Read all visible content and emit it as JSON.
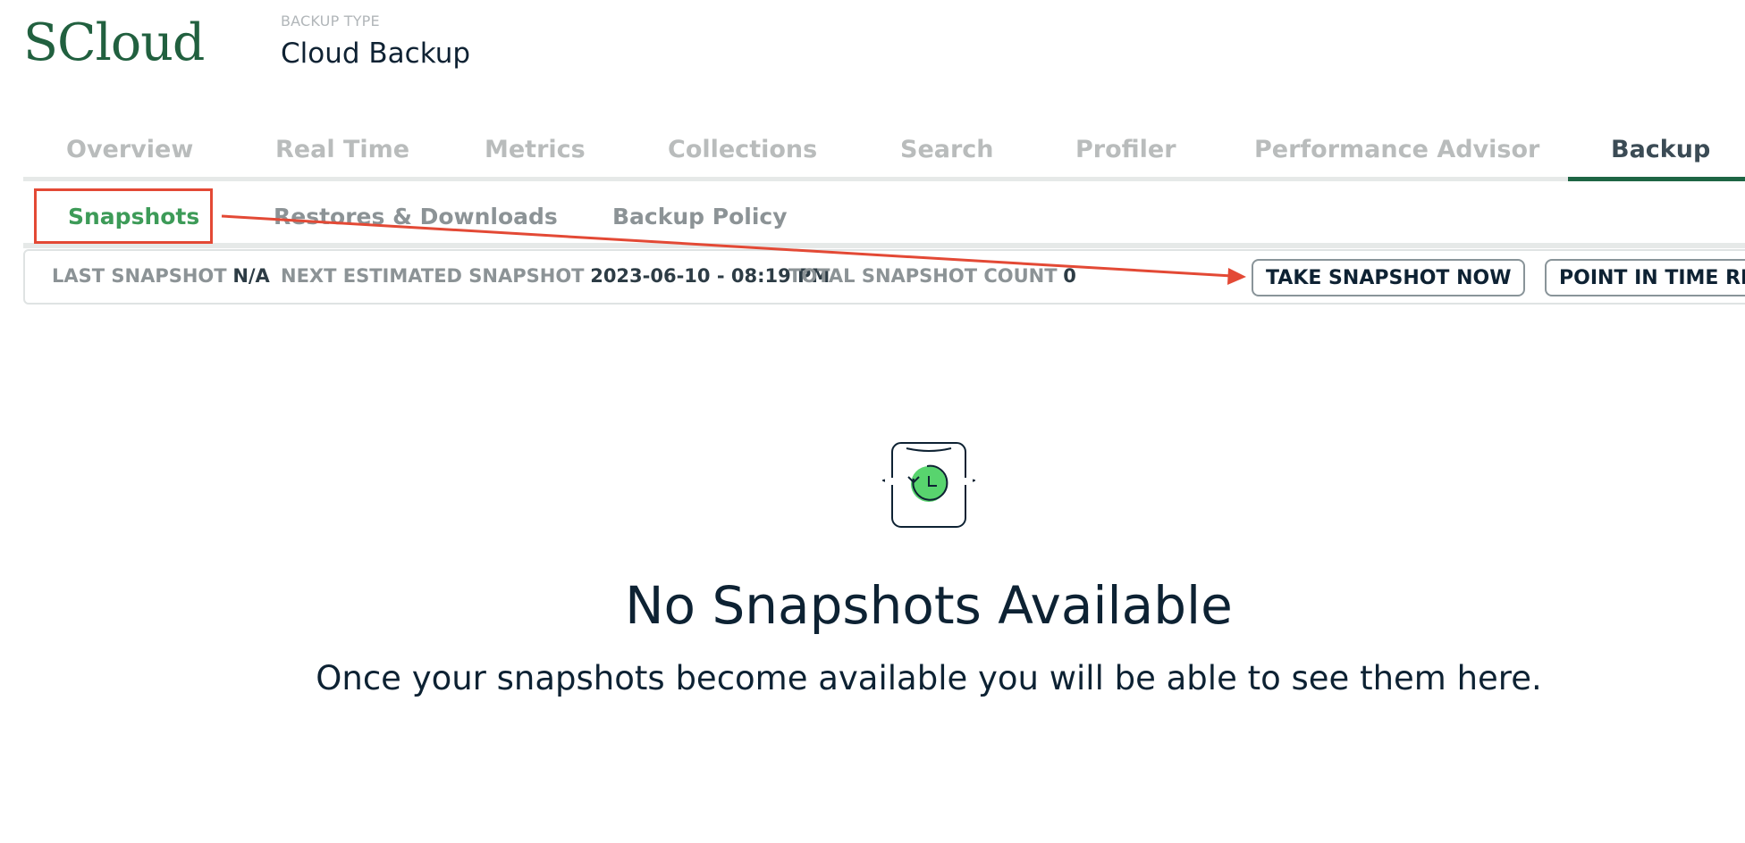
{
  "app": {
    "logo": "SCloud"
  },
  "header": {
    "backup_type_label": "BACKUP TYPE",
    "backup_type_value": "Cloud Backup"
  },
  "main_tabs": [
    {
      "label": "Overview",
      "active": false
    },
    {
      "label": "Real Time",
      "active": false
    },
    {
      "label": "Metrics",
      "active": false
    },
    {
      "label": "Collections",
      "active": false
    },
    {
      "label": "Search",
      "active": false
    },
    {
      "label": "Profiler",
      "active": false
    },
    {
      "label": "Performance Advisor",
      "active": false
    },
    {
      "label": "Backup",
      "active": true
    }
  ],
  "sub_tabs": [
    {
      "label": "Snapshots",
      "active": true
    },
    {
      "label": "Restores & Downloads",
      "active": false
    },
    {
      "label": "Backup Policy",
      "active": false
    }
  ],
  "summary": {
    "last_snapshot_label": "LAST SNAPSHOT",
    "last_snapshot_value": "N/A",
    "next_snapshot_label": "NEXT ESTIMATED SNAPSHOT",
    "next_snapshot_value": "2023-06-10 - 08:19 PM",
    "total_count_label": "TOTAL SNAPSHOT COUNT",
    "total_count_value": "0",
    "take_snapshot_button": "TAKE SNAPSHOT NOW",
    "point_in_time_button": "POINT IN TIME RE"
  },
  "empty_state": {
    "icon": "snapshot-clock-icon",
    "title": "No Snapshots Available",
    "subtitle": "Once your snapshots become available you will be able to see them here."
  },
  "colors": {
    "brand": "#21603f",
    "active_subtab": "#3d9b58",
    "annotation": "#e34935",
    "icon_green": "#58d46e"
  }
}
